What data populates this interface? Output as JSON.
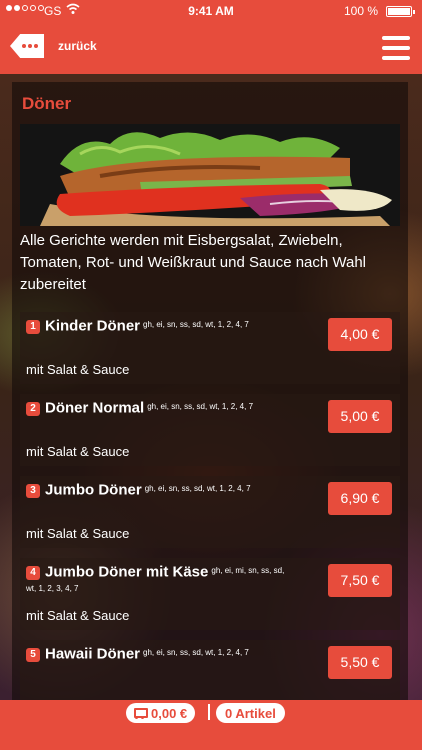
{
  "status_bar": {
    "carrier": "GS",
    "time": "9:41 AM",
    "battery": "100 %"
  },
  "nav": {
    "back_label": "zurück",
    "back_icon": "back-tag-icon",
    "menu_icon": "hamburger-menu-icon"
  },
  "category": {
    "title": "Döner",
    "description": "Alle Gerichte werden mit Eisbergsalat, Zwiebeln, Tomaten, Rot- und Weißkraut und Sauce nach Wahl zubereitet"
  },
  "items": [
    {
      "number": "1",
      "name": "Kinder Döner",
      "allergens": "gh, ei, sn, ss, sd, wt, 1, 2, 4, 7",
      "subtitle": "mit Salat & Sauce",
      "price": "4,00 €"
    },
    {
      "number": "2",
      "name": "Döner Normal",
      "allergens": "gh, ei, sn, ss, sd, wt, 1, 2, 4, 7",
      "subtitle": "mit Salat & Sauce",
      "price": "5,00 €"
    },
    {
      "number": "3",
      "name": "Jumbo Döner",
      "allergens": "gh, ei, sn, ss, sd, wt, 1, 2, 4, 7",
      "subtitle": "mit Salat & Sauce",
      "price": "6,90 €"
    },
    {
      "number": "4",
      "name": "Jumbo Döner mit Käse",
      "allergens": "gh, ei, mi, sn, ss, sd, wt, 1, 2, 3, 4, 7",
      "subtitle": "mit Salat & Sauce",
      "price": "7,50 €"
    },
    {
      "number": "5",
      "name": "Hawaii Döner",
      "allergens": "gh, ei, sn, ss, sd, wt, 1, 2, 4, 7",
      "subtitle": "",
      "price": "5,50 €"
    }
  ],
  "cart": {
    "total": "0,00 €",
    "articles": "0 Artikel"
  },
  "colors": {
    "accent": "#e74c3c"
  }
}
